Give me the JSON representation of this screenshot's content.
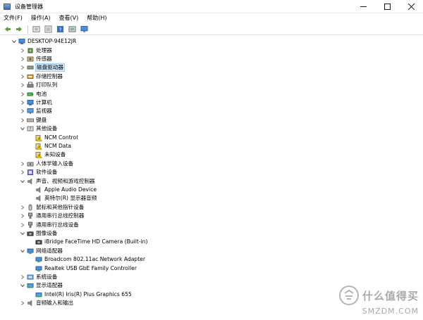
{
  "window": {
    "title": "设备管理器"
  },
  "menu": [
    "文件(F)",
    "操作(A)",
    "查看(V)",
    "帮助(H)"
  ],
  "toolbar": {
    "buttons": [
      "back-icon",
      "forward-icon",
      "properties-icon",
      "show-hidden-icon",
      "help-icon",
      "update-driver-icon",
      "monitor-icon"
    ]
  },
  "colors": {
    "selection_bg": "#cce8ff",
    "selection_border": "#99d1ff",
    "window_bg": "#ffffff"
  },
  "tree": [
    {
      "label": "DESKTOP-94E12JR",
      "level": 0,
      "expand": "expanded",
      "icon": "computer-root-icon"
    },
    {
      "label": "处理器",
      "level": 1,
      "expand": "collapsed",
      "icon": "processor-icon"
    },
    {
      "label": "传感器",
      "level": 1,
      "expand": "collapsed",
      "icon": "sensor-icon"
    },
    {
      "label": "磁盘驱动器",
      "level": 1,
      "expand": "collapsed",
      "icon": "disk-drive-icon",
      "selected": true
    },
    {
      "label": "存储控制器",
      "level": 1,
      "expand": "collapsed",
      "icon": "storage-controller-icon"
    },
    {
      "label": "打印队列",
      "level": 1,
      "expand": "collapsed",
      "icon": "printer-icon"
    },
    {
      "label": "电池",
      "level": 1,
      "expand": "collapsed",
      "icon": "battery-icon"
    },
    {
      "label": "计算机",
      "level": 1,
      "expand": "collapsed",
      "icon": "computer-icon"
    },
    {
      "label": "监视器",
      "level": 1,
      "expand": "collapsed",
      "icon": "monitor-icon"
    },
    {
      "label": "键盘",
      "level": 1,
      "expand": "collapsed",
      "icon": "keyboard-icon"
    },
    {
      "label": "其他设备",
      "level": 1,
      "expand": "expanded",
      "icon": "other-devices-icon"
    },
    {
      "label": "NCM Control",
      "level": 2,
      "expand": "none",
      "icon": "unknown-device-warning-icon"
    },
    {
      "label": "NCM Data",
      "level": 2,
      "expand": "none",
      "icon": "unknown-device-warning-icon"
    },
    {
      "label": "未知设备",
      "level": 2,
      "expand": "none",
      "icon": "unknown-device-warning-icon"
    },
    {
      "label": "人体学输入设备",
      "level": 1,
      "expand": "collapsed",
      "icon": "hid-icon"
    },
    {
      "label": "软件设备",
      "level": 1,
      "expand": "collapsed",
      "icon": "software-device-icon"
    },
    {
      "label": "声音、视频和游戏控制器",
      "level": 1,
      "expand": "expanded",
      "icon": "speaker-icon"
    },
    {
      "label": "Apple Audio Device",
      "level": 2,
      "expand": "none",
      "icon": "speaker-icon"
    },
    {
      "label": "英特尔(R) 显示器音频",
      "level": 2,
      "expand": "none",
      "icon": "speaker-icon"
    },
    {
      "label": "鼠标和其他指针设备",
      "level": 1,
      "expand": "collapsed",
      "icon": "mouse-icon"
    },
    {
      "label": "通用串行总线控制器",
      "level": 1,
      "expand": "collapsed",
      "icon": "usb-icon"
    },
    {
      "label": "通用串行总线设备",
      "level": 1,
      "expand": "collapsed",
      "icon": "usb-icon"
    },
    {
      "label": "图像设备",
      "level": 1,
      "expand": "expanded",
      "icon": "camera-icon"
    },
    {
      "label": "iBridge FaceTime HD Camera (Built-in)",
      "level": 2,
      "expand": "none",
      "icon": "camera-icon"
    },
    {
      "label": "网络适配器",
      "level": 1,
      "expand": "expanded",
      "icon": "network-adapter-icon"
    },
    {
      "label": "Broadcom 802.11ac Network Adapter",
      "level": 2,
      "expand": "none",
      "icon": "network-adapter-icon"
    },
    {
      "label": "Realtek USB GbE Family Controller",
      "level": 2,
      "expand": "none",
      "icon": "network-adapter-icon"
    },
    {
      "label": "系统设备",
      "level": 1,
      "expand": "collapsed",
      "icon": "system-device-icon"
    },
    {
      "label": "显示适配器",
      "level": 1,
      "expand": "expanded",
      "icon": "display-adapter-icon"
    },
    {
      "label": "Intel(R) Iris(R) Plus Graphics 655",
      "level": 2,
      "expand": "none",
      "icon": "display-adapter-icon"
    },
    {
      "label": "音频输入和输出",
      "level": 1,
      "expand": "collapsed",
      "icon": "audio-io-icon"
    }
  ],
  "watermark": {
    "cn": "什么值得买",
    "en": "SMZDM.COM"
  }
}
